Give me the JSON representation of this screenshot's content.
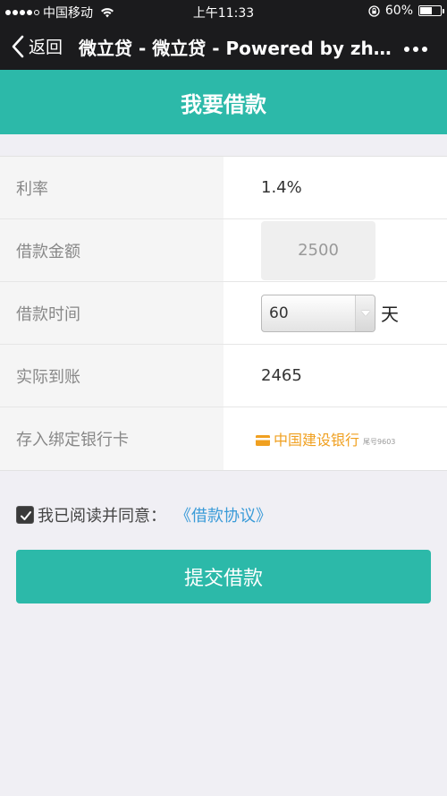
{
  "status_bar": {
    "carrier": "中国移动",
    "time": "上午11:33",
    "battery": "60%",
    "battery_level": 0.6,
    "signal_dots_filled": 4,
    "signal_dots_total": 5
  },
  "nav": {
    "back_label": "返回",
    "title": "微立贷 - 微立贷 - Powered by zhi..."
  },
  "header": {
    "title": "我要借款"
  },
  "form": {
    "rate": {
      "label": "利率",
      "value": "1.4%"
    },
    "amount": {
      "label": "借款金额",
      "value": "2500"
    },
    "duration": {
      "label": "借款时间",
      "selected": "60",
      "unit": "天"
    },
    "actual": {
      "label": "实际到账",
      "value": "2465"
    },
    "bank": {
      "label": "存入绑定银行卡",
      "name": "中国建设银行",
      "tail": "尾号9603"
    }
  },
  "agreement": {
    "text": "我已阅读并同意：",
    "link": "《借款协议》",
    "checked": true
  },
  "submit": {
    "label": "提交借款"
  },
  "colors": {
    "accent": "#2cb9a9",
    "bar": "#1b1b1d",
    "link": "#3a9bd8",
    "bank": "#f0a020"
  }
}
